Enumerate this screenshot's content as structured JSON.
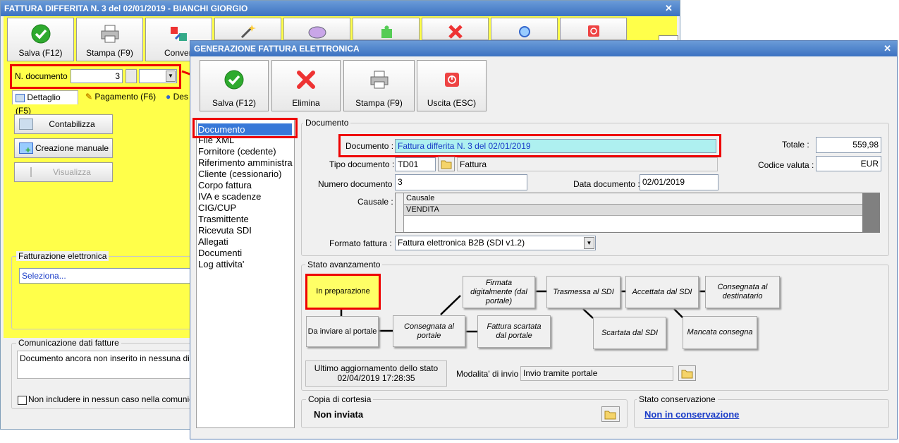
{
  "back": {
    "title": "FATTURA DIFFERITA N. 3 del 02/01/2019 - BIANCHI GIORGIO",
    "toolbar": {
      "save": "Salva (F12)",
      "print": "Stampa (F9)",
      "convert": "Conver"
    },
    "num_doc_label": "N. documento :",
    "num_doc_value": "3",
    "tabs": {
      "detail": "Dettaglio (F5)",
      "payment": "Pagamento (F6)",
      "des": "Des"
    },
    "buttons": {
      "post": "Contabilizza",
      "manual": "Creazione manuale",
      "view": "Visualizza"
    },
    "efatt_group": "Fatturazione elettronica",
    "efatt_select": "Seleziona...",
    "comm_group": "Comunicazione dati fatture",
    "comm_text": "Documento ancora non inserito in nessuna distinta",
    "comm_check": "Non includere in nessun caso nella comunicazione"
  },
  "front": {
    "title": "GENERAZIONE FATTURA ELETTRONICA",
    "toolbar": {
      "save": "Salva (F12)",
      "delete": "Elimina",
      "print": "Stampa (F9)",
      "exit": "Uscita (ESC)"
    },
    "nav": [
      "Documento",
      "File XML",
      "Fornitore (cedente)",
      "Riferimento amministra",
      "Cliente (cessionario)",
      "Corpo fattura",
      "IVA e scadenze",
      "CIG/CUP",
      "Trasmittente",
      "Ricevuta SDI",
      "Allegati",
      "Documenti",
      "Log attivita'"
    ],
    "doc_group": "Documento",
    "documento_label": "Documento :",
    "documento_value": "Fattura differita N. 3 del 02/01/2019",
    "tipo_label": "Tipo documento :",
    "tipo_code": "TD01",
    "tipo_desc": "Fattura",
    "numero_label": "Numero documento :",
    "numero_value": "3",
    "data_label": "Data documento :",
    "data_value": "02/01/2019",
    "totale_label": "Totale :",
    "totale_value": "559,98",
    "valuta_label": "Codice valuta :",
    "valuta_value": "EUR",
    "causale_label": "Causale :",
    "causale_header": "Causale",
    "causale_row": "VENDITA",
    "formato_label": "Formato fattura :",
    "formato_value": "Fattura elettronica B2B (SDI v1.2)",
    "stato_group": "Stato avanzamento",
    "states": {
      "prep": "In preparazione",
      "da_inviare": "Da inviare al portale",
      "consegnata_portale": "Consegnata al portale",
      "firmata": "Firmata digitalmente (dal portale)",
      "scartata_portale": "Fattura scartata dal portale",
      "trasmessa": "Trasmessa al SDI",
      "scartata_sdi": "Scartata dal SDI",
      "accettata": "Accettata dal SDI",
      "mancata": "Mancata consegna",
      "consegnata_dest": "Consegnata al destinatario"
    },
    "ultimo_label": "Ultimo aggiornamento dello stato",
    "ultimo_value": "02/04/2019 17:28:35",
    "modalita_label": "Modalita' di invio :",
    "modalita_value": "Invio tramite portale",
    "copia_group": "Copia di cortesia",
    "copia_value": "Non inviata",
    "conserv_group": "Stato conservazione",
    "conserv_value": "Non in conservazione"
  },
  "colors": {
    "accent_red": "#ee0000",
    "highlight_yellow": "#ffff66",
    "back_yellow": "#ffff4a",
    "title_blue": "#3c72c2",
    "link_blue": "#1a3cc8"
  }
}
